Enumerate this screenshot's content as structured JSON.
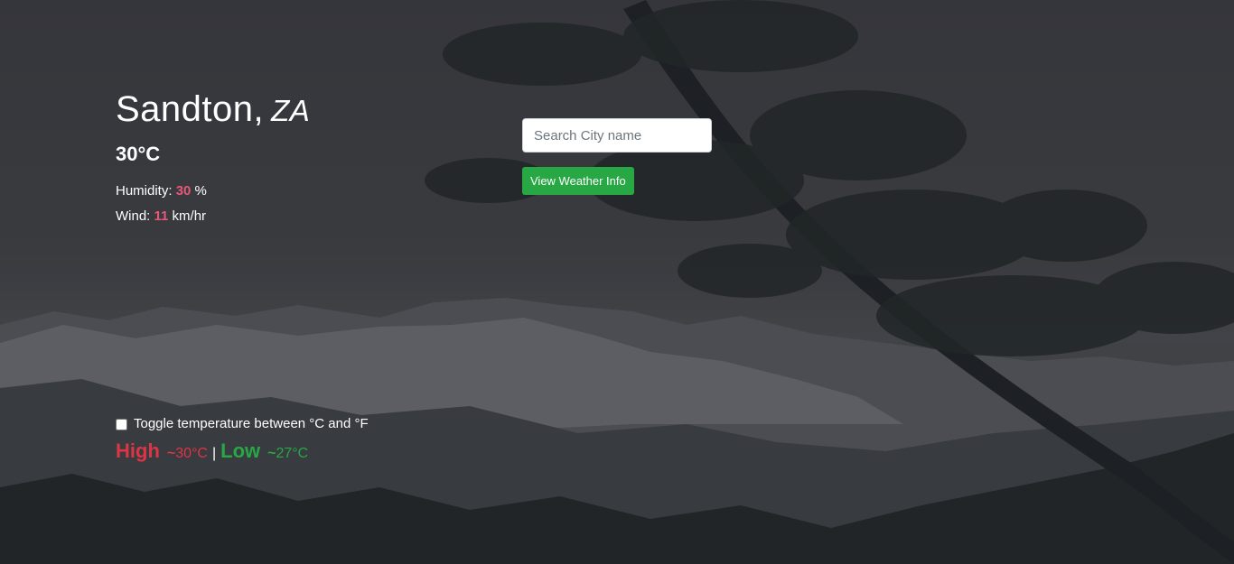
{
  "location": {
    "city": "Sandton,",
    "country": "ZA"
  },
  "current": {
    "temperature": "30°C",
    "humidity_label": "Humidity:",
    "humidity_value": "30",
    "humidity_unit": "%",
    "wind_label": "Wind:",
    "wind_value": "11",
    "wind_unit": "km/hr"
  },
  "search": {
    "placeholder": "Search City name",
    "value": "",
    "button_label": "View Weather Info"
  },
  "toggle": {
    "label": "Toggle temperature between °C and °F",
    "checked": false
  },
  "range": {
    "high_label": "High",
    "high_tilde": "~",
    "high_value": "30°C",
    "separator": "|",
    "low_label": "Low",
    "low_tilde": "~",
    "low_value": "27°C"
  },
  "colors": {
    "accent_red": "#dc3545",
    "accent_pink": "#e8577a",
    "accent_green": "#28a745"
  }
}
